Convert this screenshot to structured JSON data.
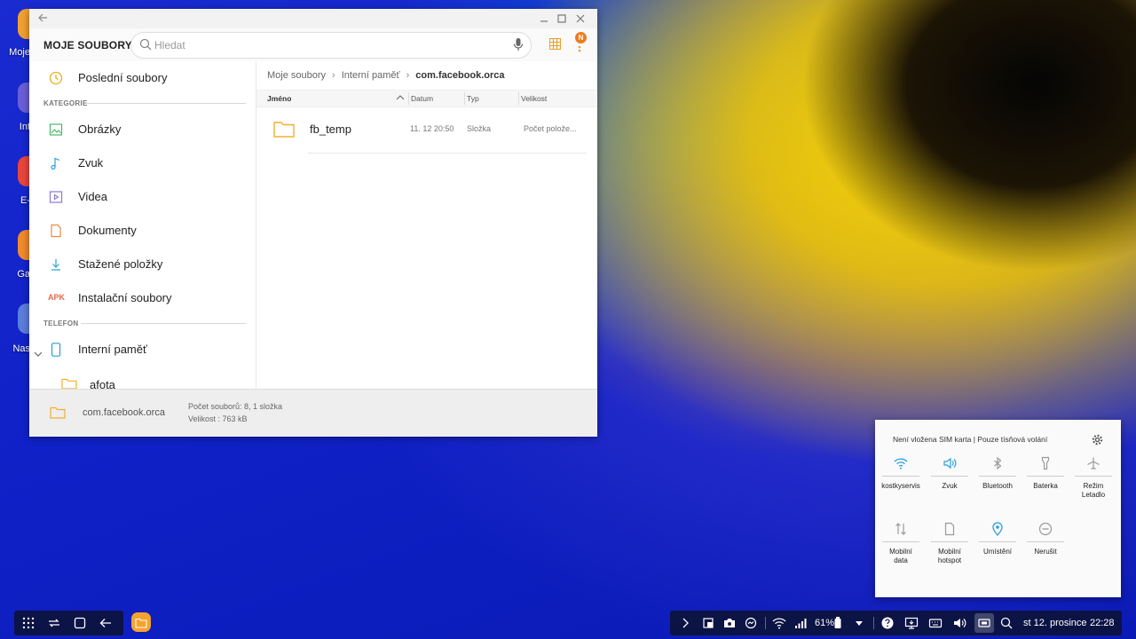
{
  "desktop": {
    "icons": [
      {
        "label": "Moje",
        "color": "#f0a030"
      },
      {
        "label": "Int",
        "color": "#6a5fd8"
      },
      {
        "label": "E-",
        "color": "#e8453c"
      },
      {
        "label": "Ga",
        "color": "#f08a2d"
      },
      {
        "label": "Nas",
        "color": "#5d7dde"
      }
    ]
  },
  "window": {
    "title": "MOJE SOUBORY",
    "search_placeholder": "Hledat",
    "notification_badge": "N",
    "sidebar": {
      "recent": "Poslední soubory",
      "section_categories": "KATEGORIE",
      "categories": [
        {
          "label": "Obrázky",
          "icon": "image-icon"
        },
        {
          "label": "Zvuk",
          "icon": "music-icon"
        },
        {
          "label": "Videa",
          "icon": "video-icon"
        },
        {
          "label": "Dokumenty",
          "icon": "document-icon"
        },
        {
          "label": "Stažené položky",
          "icon": "download-icon"
        },
        {
          "label": "Instalační soubory",
          "icon": "apk-icon",
          "icon_text": "APK"
        }
      ],
      "section_phone": "TELEFON",
      "internal_storage": "Interní paměť",
      "subfolder": "afota"
    },
    "breadcrumb": [
      "Moje soubory",
      "Interní paměť",
      "com.facebook.orca"
    ],
    "columns": {
      "name": "Jméno",
      "date": "Datum",
      "type": "Typ",
      "size": "Velikost"
    },
    "files": [
      {
        "name": "fb_temp",
        "date": "11. 12 20:50",
        "type": "Složka",
        "size": "Počet polože..."
      }
    ],
    "footer": {
      "folder": "com.facebook.orca",
      "count": "Počet souborů: 8, 1 složka",
      "size": "Velikost : 763 kB"
    }
  },
  "quick_panel": {
    "status": "Není vložena SIM karta | Pouze tísňová volání",
    "tiles": [
      {
        "label": "kostkyservis",
        "active": true
      },
      {
        "label": "Zvuk",
        "active": true
      },
      {
        "label": "Bluetooth",
        "active": false
      },
      {
        "label": "Baterka",
        "active": false
      },
      {
        "label": "Režim Letadlo",
        "active": false
      },
      {
        "label": "Mobilní data",
        "active": false
      },
      {
        "label": "Mobilní hotspot",
        "active": false
      },
      {
        "label": "Umístění",
        "active": true
      },
      {
        "label": "Nerušit",
        "active": false
      }
    ]
  },
  "taskbar": {
    "battery": "61%",
    "date": "st 12. prosince",
    "time": "22:28"
  },
  "colors": {
    "accent_orange": "#f6a32d",
    "active_blue": "#2a9fd8",
    "inactive_gray": "#9a9a9a"
  }
}
